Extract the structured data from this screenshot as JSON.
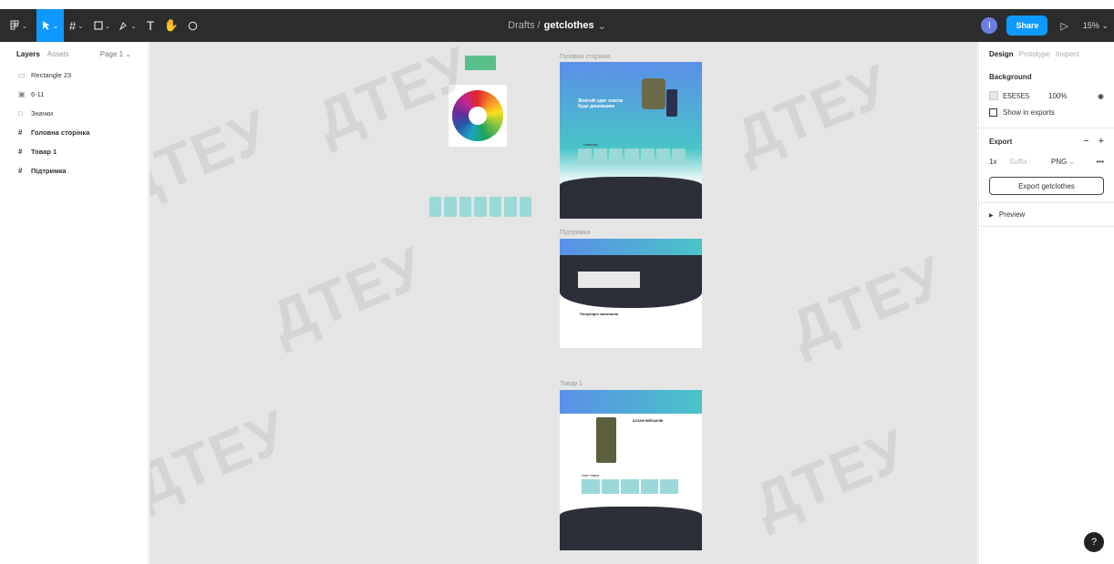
{
  "toolbar": {
    "breadcrumb_drafts": "Drafts /",
    "file_name": "getclothes",
    "avatar_letter": "I",
    "share_label": "Share",
    "zoom": "15%"
  },
  "layers_panel": {
    "tab_layers": "Layers",
    "tab_assets": "Assets",
    "page": "Page 1",
    "items": [
      {
        "label": "Rectangle 23"
      },
      {
        "label": "6-11"
      },
      {
        "label": "Значки"
      },
      {
        "label": "Головна сторінка"
      },
      {
        "label": "Товар 1"
      },
      {
        "label": "Підтримка"
      }
    ]
  },
  "canvas": {
    "frames": {
      "home": {
        "label": "Головна сторінка",
        "hero_text": "Жовтий одяг зовсім буде дешевшим",
        "section_title": "Новинки"
      },
      "support": {
        "label": "Підтримка",
        "faq_title": "Популярні запитання"
      },
      "product": {
        "label": "Товар 1",
        "product_title": "ШТАНИ ВІЙСЬКОВІ",
        "section_title": "Нові товари"
      }
    },
    "watermark": "ДТЕУ",
    "colors": {
      "accent": "#0d99ff",
      "teal": "#49c4c6",
      "dark": "#2c2f38",
      "green_rect": "#5bbf8c"
    }
  },
  "design_panel": {
    "tab_design": "Design",
    "tab_prototype": "Prototype",
    "tab_inspect": "Inspect",
    "background_title": "Background",
    "bg_hex": "E5E5E5",
    "bg_opacity": "100%",
    "show_in_exports": "Show in exports",
    "export_title": "Export",
    "export_scale": "1x",
    "export_suffix": "Suffix",
    "export_format": "PNG",
    "export_button": "Export getclothes",
    "preview": "Preview"
  }
}
